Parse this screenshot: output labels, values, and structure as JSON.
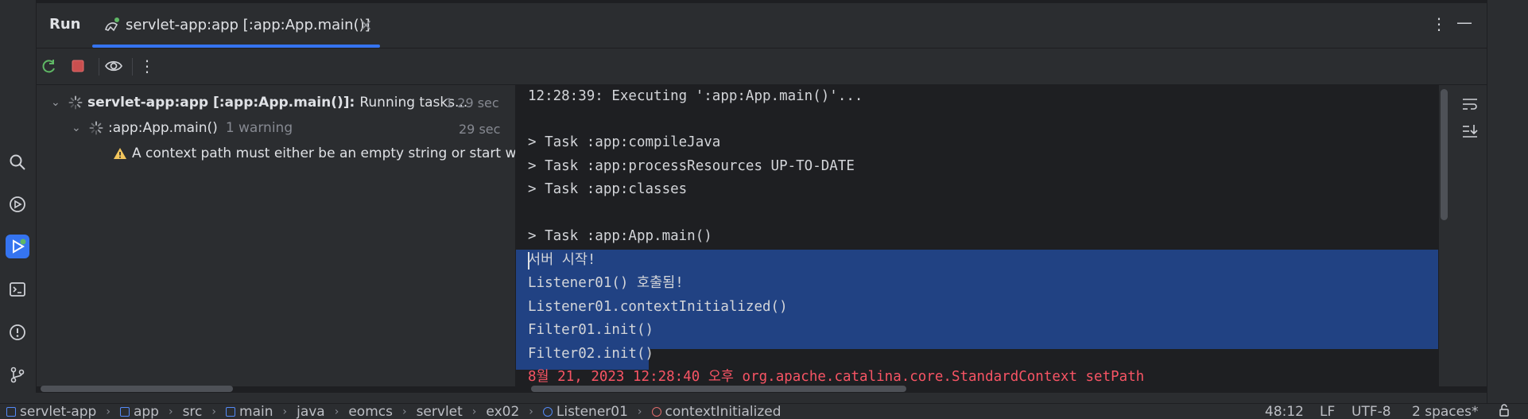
{
  "header": {
    "tool_title": "Run",
    "tab_label": "servlet-app:app [:app:App.main()]",
    "close_symbol": "×",
    "more_symbol": "⋮",
    "minimize_symbol": "—"
  },
  "toolbar": {
    "more_symbol": "⋮"
  },
  "tree": {
    "root": {
      "name": "servlet-app:app [:app:App.main()]:",
      "status": "Running tasks...",
      "duration": "1 29 sec"
    },
    "child": {
      "name": ":app:App.main()",
      "note": "1 warning",
      "duration": "29 sec"
    },
    "warning": {
      "text": "A context path must either be an empty string or start with"
    }
  },
  "console": {
    "lines": [
      "12:28:39: Executing ':app:App.main()'...",
      "",
      "> Task :app:compileJava",
      "> Task :app:processResources UP-TO-DATE",
      "> Task :app:classes",
      "",
      "> Task :app:App.main()",
      "서버 시작!",
      "Listener01() 호출됨!",
      "Listener01.contextInitialized()",
      "Filter01.init()",
      "Filter02.init()",
      "8월 21, 2023 12:28:40 오후 org.apache.catalina.core.StandardContext setPath"
    ]
  },
  "statusbar": {
    "breadcrumbs": [
      "servlet-app",
      "app",
      "src",
      "main",
      "java",
      "eomcs",
      "servlet",
      "ex02",
      "Listener01",
      "contextInitialized"
    ],
    "crumb_sep": "›",
    "position": "48:12",
    "line_ending": "LF",
    "encoding": "UTF-8",
    "indent": "2 spaces*"
  },
  "colors": {
    "accent": "#3574f0",
    "selection": "#214283",
    "error_text": "#f75464",
    "warning": "#f2c55c",
    "running_green": "#5fb865"
  }
}
